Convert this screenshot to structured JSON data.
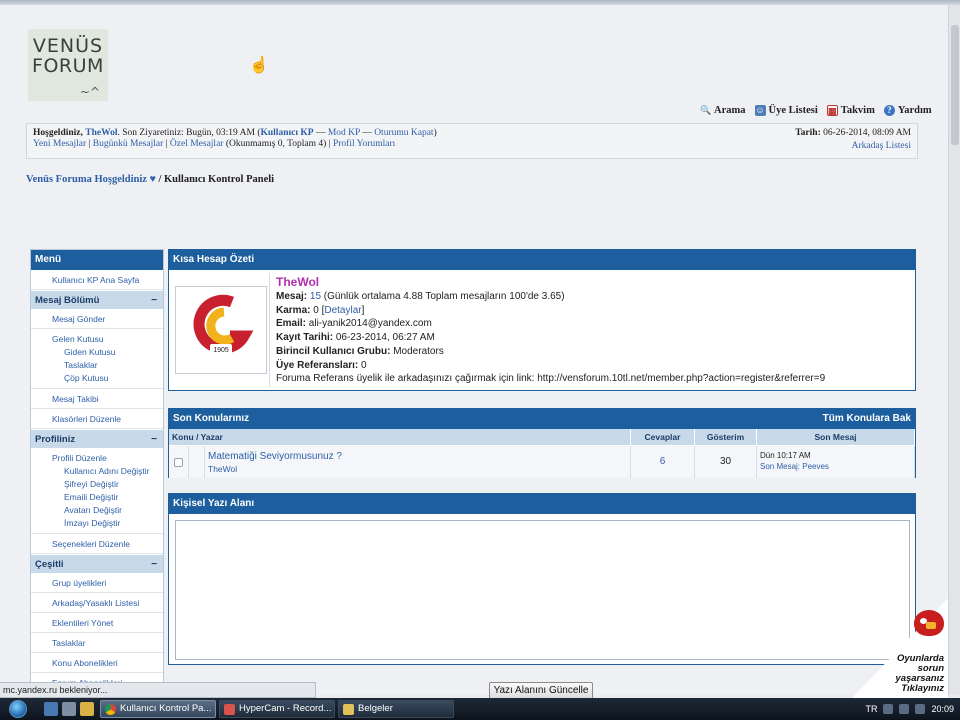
{
  "logo": {
    "line1": "VENÜS",
    "line2": "FORUM",
    "squiggle": "~^"
  },
  "topnav": [
    {
      "label": "Arama",
      "icon": "search-icon"
    },
    {
      "label": "Üye Listesi",
      "icon": "members-icon"
    },
    {
      "label": "Takvim",
      "icon": "calendar-icon"
    },
    {
      "label": "Yardım",
      "icon": "help-icon"
    }
  ],
  "welcome": {
    "greeting": "Hoşgeldiniz,",
    "username": "TheWol",
    "last_visit": ". Son Ziyaretiniz: Bugün, 03:19 AM (",
    "cp_link": "Kullanıcı KP",
    "sep1": " — ",
    "modcp_link": "Mod KP",
    "sep2": " — ",
    "logout_link": "Oturumu Kapat",
    "close_paren": ")",
    "links": [
      "Yeni Mesajlar",
      "Bugünkü Mesajlar",
      "Özel Mesajlar"
    ],
    "pm_counts": " (Okunmamış 0, Toplam 4) | ",
    "profile_comments": "Profil Yorumları",
    "date_label": "Tarih:",
    "date_value": " 06-26-2014, 08:09 AM",
    "friends_link": "Arkadaş Listesi"
  },
  "breadcrumb": {
    "home": "Venüs Foruma Hoşgeldiniz ♥",
    "sep": " / ",
    "current": "Kullanıcı Kontrol Paneli"
  },
  "sidebar": {
    "title": "Menü",
    "home_link": "Kullanıcı KP Ana Sayfa",
    "sections": {
      "messages": "Mesaj Bölümü",
      "profile": "Profiliniz",
      "misc": "Çeşitli"
    },
    "collapse_glyph": "−",
    "messages_items": {
      "send": "Mesaj Gönder",
      "inbox": "Gelen Kutusu",
      "outbox": "Giden Kutusu",
      "drafts": "Taslaklar",
      "trash": "Çöp Kutusu",
      "tracking": "Mesaj Takibi",
      "folders": "Klasörleri Düzenle"
    },
    "profile_items": {
      "edit": "Profili Düzenle",
      "username": "Kullanıcı Adını Değiştir",
      "password": "Şifreyi Değiştir",
      "email": "Emaili Değiştir",
      "avatar": "Avatarı Değiştir",
      "signature": "İmzayı Değiştir",
      "options": "Seçenekleri Düzenle"
    },
    "misc_items": [
      "Grup üyelikleri",
      "Arkadaş/Yasaklı Listesi",
      "Eklentileri Yönet",
      "Taslaklar",
      "Konu Abonelikleri",
      "Forum Abonelikleri"
    ]
  },
  "summary": {
    "title": "Kısa Hesap Özeti",
    "username": "TheWol",
    "posts_label": "Mesaj:",
    "posts_value": "15",
    "posts_extra": " (Günlük ortalama 4.88 Toplam mesajların 100'de 3.65)",
    "karma_label": "Karma:",
    "karma_value": " 0 [",
    "karma_link": "Detaylar",
    "karma_close": "]",
    "email_label": "Email:",
    "email_value": " ali-yanik2014@yandex.com",
    "reg_label": "Kayıt Tarihi:",
    "reg_value": " 06-23-2014, 06:27 AM",
    "group_label": "Birincil Kullanıcı Grubu:",
    "group_value": " Moderators",
    "ref_label": "Üye Referansları:",
    "ref_value": " 0",
    "ref_text": "Foruma Referans üyelik ile arkadaşınızı çağırmak için link: http://vensforum.10tl.net/member.php?action=register&referrer=9",
    "avatar_badge": "1905"
  },
  "threads": {
    "title": "Son Konularınız",
    "view_all": "Tüm Konulara Bak",
    "columns": [
      "Konu / Yazar",
      "Cevaplar",
      "Gösterim",
      "Son Mesaj"
    ],
    "rows": [
      {
        "title": "Matematiği Seviyormusunuz ?",
        "author": "TheWol",
        "replies": "6",
        "views": "30",
        "last_time": "Dün 10:17 AM",
        "last_by": "Son Mesaj: Peeves"
      }
    ]
  },
  "notes": {
    "title": "Kişisel Yazı Alanı",
    "content": ""
  },
  "update_button": "Yazı Alanını Güncelle",
  "status_text": "mc.yandex.ru bekleniyor...",
  "sticker": {
    "l1": "Oyunlarda",
    "l2": "sorun",
    "l3": "yaşarsanız",
    "l4": "Tıklayınız"
  },
  "taskbar": {
    "tasks": [
      "Kullanıcı Kontrol Pa...",
      "HyperCam - Record...",
      "Belgeler"
    ],
    "lang": "TR",
    "time": "20:09"
  }
}
